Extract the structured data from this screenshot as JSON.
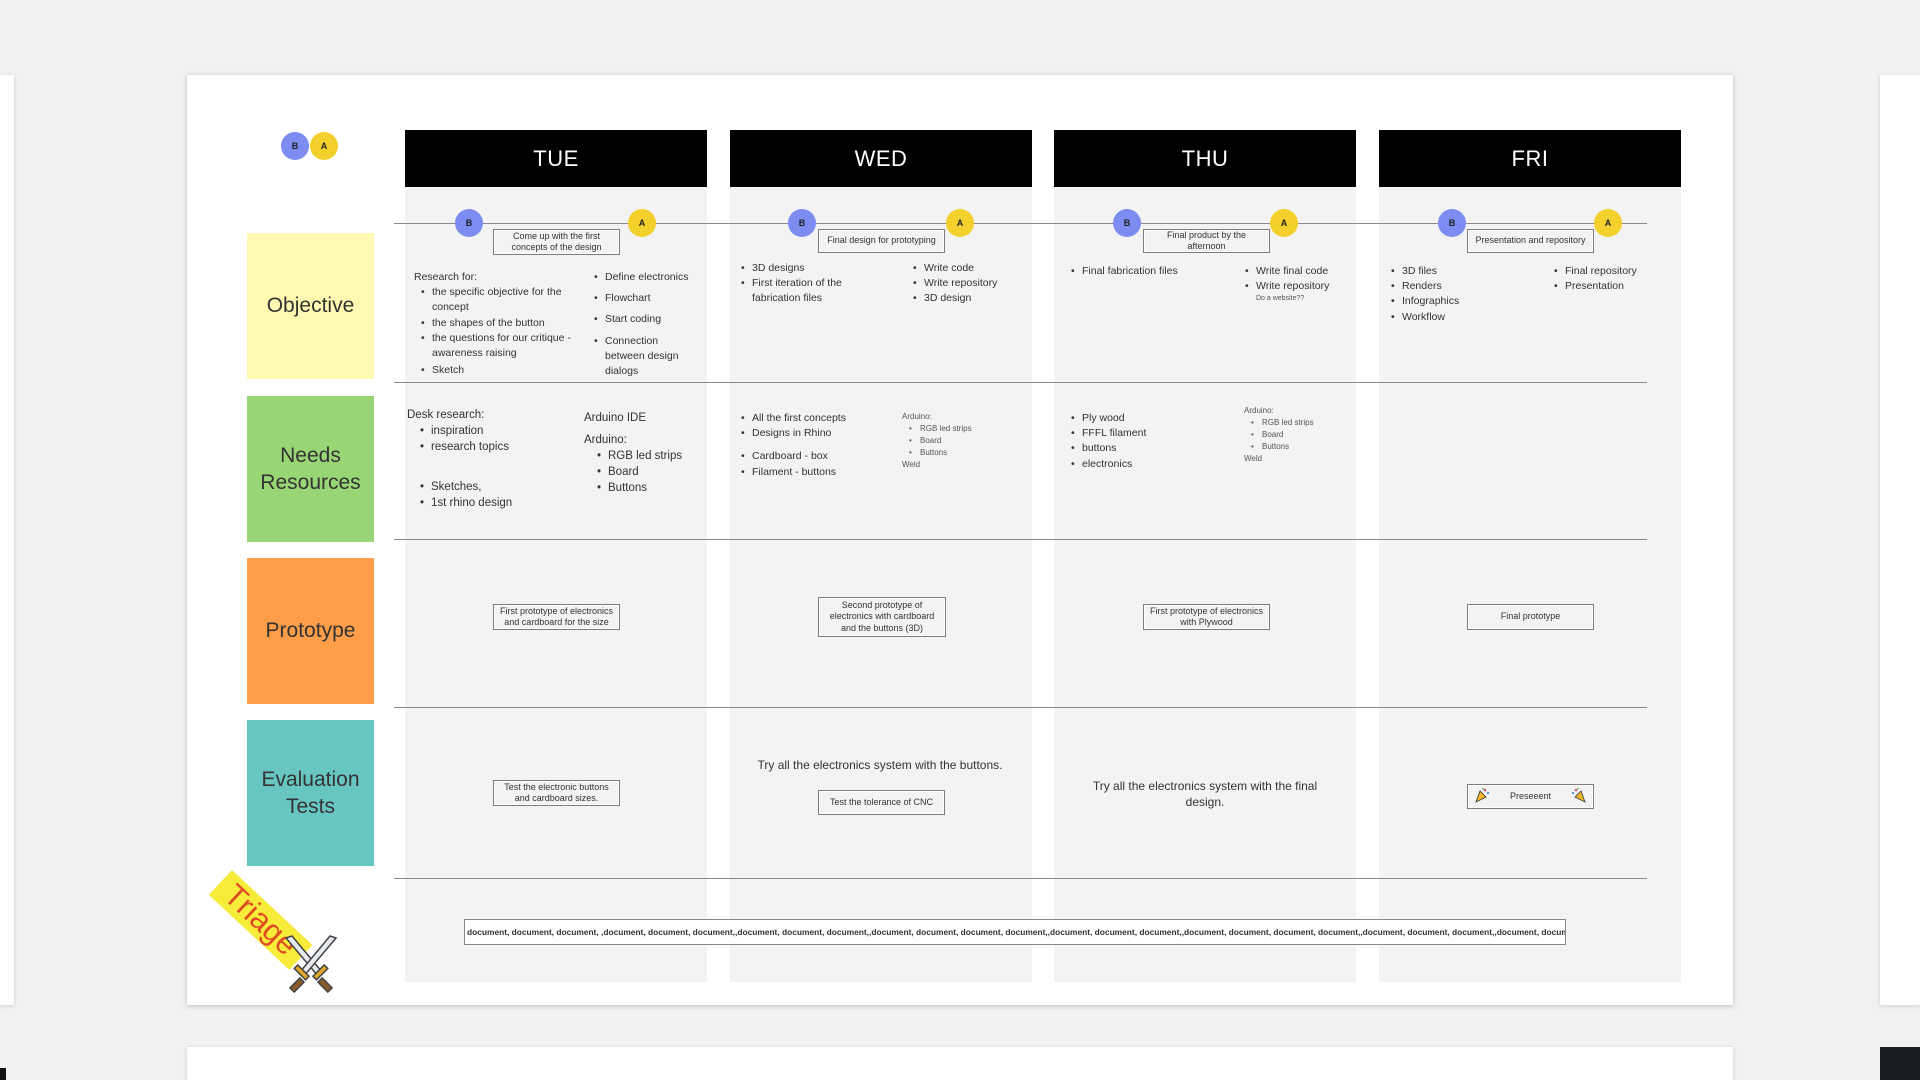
{
  "avatars": {
    "b": "B",
    "a": "A"
  },
  "days": [
    "TUE",
    "WED",
    "THU",
    "FRI"
  ],
  "rows": {
    "objective": "Objective",
    "needs": "Needs Resources",
    "prototype": "Prototype",
    "evaluation": "Evaluation Tests"
  },
  "goals": {
    "tue": "Come up with the first concepts of the design",
    "wed": "Final design for prototyping",
    "thu": "Final product by the afternoon",
    "fri": "Presentation and repository"
  },
  "objective": {
    "tue_heading": "Research for:",
    "tue_left": [
      "the specific objective for the concept",
      "the shapes of the button",
      "the questions for our critique - awareness raising",
      "Sketch"
    ],
    "tue_right": [
      "Define electronics",
      "Flowchart",
      "Start coding",
      "Connection between design dialogs"
    ],
    "wed_left": [
      "3D designs",
      "First iteration of the fabrication files"
    ],
    "wed_right": [
      "Write code",
      "Write repository",
      "3D design"
    ],
    "thu_left": [
      "Final fabrication files"
    ],
    "thu_right": [
      "Write final code",
      "Write repository"
    ],
    "thu_note": "Do a website??",
    "fri_left": [
      "3D files",
      "Renders",
      "Infographics",
      "Workflow"
    ],
    "fri_right": [
      "Final repository",
      "Presentation"
    ]
  },
  "needs": {
    "tue_heading": "Desk research:",
    "tue_list1": [
      "inspiration",
      "research topics"
    ],
    "tue_list2": [
      "Sketches,",
      "1st rhino design"
    ],
    "tue_ide": "Arduino IDE",
    "tue_arduino": "Arduino:",
    "tue_arduino_items": [
      "RGB led strips",
      "Board",
      "Buttons"
    ],
    "wed_list1": [
      "All the first concepts",
      "Designs in Rhino"
    ],
    "wed_list2": [
      "Cardboard - box",
      "Filament - buttons"
    ],
    "wed_arduino": "Arduino:",
    "wed_arduino_items": [
      "RGB led strips",
      "Board",
      "Buttons"
    ],
    "wed_weld": "Weld",
    "thu_list": [
      "Ply wood",
      "FFFL filament",
      "buttons",
      "electronics"
    ],
    "thu_arduino": "Arduino:",
    "thu_arduino_items": [
      "RGB led strips",
      "Board",
      "Buttons"
    ],
    "thu_weld": "Weld"
  },
  "prototype": {
    "tue": "First prototype of electronics and cardboard for the size",
    "wed": "Second prototype of electronics with cardboard and the buttons (3D)",
    "thu": "First prototype of electronics with Plywood",
    "fri": "Final prototype"
  },
  "evaluation": {
    "tue": "Test the electronic buttons and cardboard sizes.",
    "wed_text": "Try all the electronics system with the buttons.",
    "wed_box": "Test the tolerance of CNC",
    "thu_text": "Try all the electronics system with the final design.",
    "fri": "Preseeent"
  },
  "triage": {
    "label": "Triage",
    "documents": "document, document, document, ,document, document, document,,document, document, document,,document, document, document, document,,document, document, document,,document, document, document, document,,document, document, document,,document, document"
  },
  "colors": {
    "objective": "#fff9b1",
    "needs": "#98d675",
    "prototype": "#ff9d48",
    "evaluation": "#67c6c0",
    "avatar_b": "#7c8cf1",
    "avatar_a": "#f3d02c",
    "header": "#000000"
  }
}
